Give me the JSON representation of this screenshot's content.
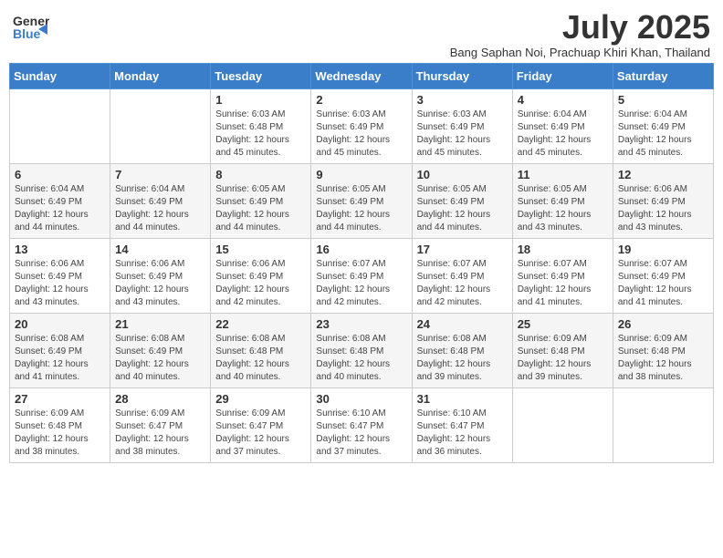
{
  "logo": {
    "general": "General",
    "blue": "Blue"
  },
  "title": {
    "month_year": "July 2025",
    "location": "Bang Saphan Noi, Prachuap Khiri Khan, Thailand"
  },
  "days_of_week": [
    "Sunday",
    "Monday",
    "Tuesday",
    "Wednesday",
    "Thursday",
    "Friday",
    "Saturday"
  ],
  "weeks": [
    [
      {
        "day": "",
        "sunrise": "",
        "sunset": "",
        "daylight": ""
      },
      {
        "day": "",
        "sunrise": "",
        "sunset": "",
        "daylight": ""
      },
      {
        "day": "1",
        "sunrise": "Sunrise: 6:03 AM",
        "sunset": "Sunset: 6:48 PM",
        "daylight": "Daylight: 12 hours and 45 minutes."
      },
      {
        "day": "2",
        "sunrise": "Sunrise: 6:03 AM",
        "sunset": "Sunset: 6:49 PM",
        "daylight": "Daylight: 12 hours and 45 minutes."
      },
      {
        "day": "3",
        "sunrise": "Sunrise: 6:03 AM",
        "sunset": "Sunset: 6:49 PM",
        "daylight": "Daylight: 12 hours and 45 minutes."
      },
      {
        "day": "4",
        "sunrise": "Sunrise: 6:04 AM",
        "sunset": "Sunset: 6:49 PM",
        "daylight": "Daylight: 12 hours and 45 minutes."
      },
      {
        "day": "5",
        "sunrise": "Sunrise: 6:04 AM",
        "sunset": "Sunset: 6:49 PM",
        "daylight": "Daylight: 12 hours and 45 minutes."
      }
    ],
    [
      {
        "day": "6",
        "sunrise": "Sunrise: 6:04 AM",
        "sunset": "Sunset: 6:49 PM",
        "daylight": "Daylight: 12 hours and 44 minutes."
      },
      {
        "day": "7",
        "sunrise": "Sunrise: 6:04 AM",
        "sunset": "Sunset: 6:49 PM",
        "daylight": "Daylight: 12 hours and 44 minutes."
      },
      {
        "day": "8",
        "sunrise": "Sunrise: 6:05 AM",
        "sunset": "Sunset: 6:49 PM",
        "daylight": "Daylight: 12 hours and 44 minutes."
      },
      {
        "day": "9",
        "sunrise": "Sunrise: 6:05 AM",
        "sunset": "Sunset: 6:49 PM",
        "daylight": "Daylight: 12 hours and 44 minutes."
      },
      {
        "day": "10",
        "sunrise": "Sunrise: 6:05 AM",
        "sunset": "Sunset: 6:49 PM",
        "daylight": "Daylight: 12 hours and 44 minutes."
      },
      {
        "day": "11",
        "sunrise": "Sunrise: 6:05 AM",
        "sunset": "Sunset: 6:49 PM",
        "daylight": "Daylight: 12 hours and 43 minutes."
      },
      {
        "day": "12",
        "sunrise": "Sunrise: 6:06 AM",
        "sunset": "Sunset: 6:49 PM",
        "daylight": "Daylight: 12 hours and 43 minutes."
      }
    ],
    [
      {
        "day": "13",
        "sunrise": "Sunrise: 6:06 AM",
        "sunset": "Sunset: 6:49 PM",
        "daylight": "Daylight: 12 hours and 43 minutes."
      },
      {
        "day": "14",
        "sunrise": "Sunrise: 6:06 AM",
        "sunset": "Sunset: 6:49 PM",
        "daylight": "Daylight: 12 hours and 43 minutes."
      },
      {
        "day": "15",
        "sunrise": "Sunrise: 6:06 AM",
        "sunset": "Sunset: 6:49 PM",
        "daylight": "Daylight: 12 hours and 42 minutes."
      },
      {
        "day": "16",
        "sunrise": "Sunrise: 6:07 AM",
        "sunset": "Sunset: 6:49 PM",
        "daylight": "Daylight: 12 hours and 42 minutes."
      },
      {
        "day": "17",
        "sunrise": "Sunrise: 6:07 AM",
        "sunset": "Sunset: 6:49 PM",
        "daylight": "Daylight: 12 hours and 42 minutes."
      },
      {
        "day": "18",
        "sunrise": "Sunrise: 6:07 AM",
        "sunset": "Sunset: 6:49 PM",
        "daylight": "Daylight: 12 hours and 41 minutes."
      },
      {
        "day": "19",
        "sunrise": "Sunrise: 6:07 AM",
        "sunset": "Sunset: 6:49 PM",
        "daylight": "Daylight: 12 hours and 41 minutes."
      }
    ],
    [
      {
        "day": "20",
        "sunrise": "Sunrise: 6:08 AM",
        "sunset": "Sunset: 6:49 PM",
        "daylight": "Daylight: 12 hours and 41 minutes."
      },
      {
        "day": "21",
        "sunrise": "Sunrise: 6:08 AM",
        "sunset": "Sunset: 6:49 PM",
        "daylight": "Daylight: 12 hours and 40 minutes."
      },
      {
        "day": "22",
        "sunrise": "Sunrise: 6:08 AM",
        "sunset": "Sunset: 6:48 PM",
        "daylight": "Daylight: 12 hours and 40 minutes."
      },
      {
        "day": "23",
        "sunrise": "Sunrise: 6:08 AM",
        "sunset": "Sunset: 6:48 PM",
        "daylight": "Daylight: 12 hours and 40 minutes."
      },
      {
        "day": "24",
        "sunrise": "Sunrise: 6:08 AM",
        "sunset": "Sunset: 6:48 PM",
        "daylight": "Daylight: 12 hours and 39 minutes."
      },
      {
        "day": "25",
        "sunrise": "Sunrise: 6:09 AM",
        "sunset": "Sunset: 6:48 PM",
        "daylight": "Daylight: 12 hours and 39 minutes."
      },
      {
        "day": "26",
        "sunrise": "Sunrise: 6:09 AM",
        "sunset": "Sunset: 6:48 PM",
        "daylight": "Daylight: 12 hours and 38 minutes."
      }
    ],
    [
      {
        "day": "27",
        "sunrise": "Sunrise: 6:09 AM",
        "sunset": "Sunset: 6:48 PM",
        "daylight": "Daylight: 12 hours and 38 minutes."
      },
      {
        "day": "28",
        "sunrise": "Sunrise: 6:09 AM",
        "sunset": "Sunset: 6:47 PM",
        "daylight": "Daylight: 12 hours and 38 minutes."
      },
      {
        "day": "29",
        "sunrise": "Sunrise: 6:09 AM",
        "sunset": "Sunset: 6:47 PM",
        "daylight": "Daylight: 12 hours and 37 minutes."
      },
      {
        "day": "30",
        "sunrise": "Sunrise: 6:10 AM",
        "sunset": "Sunset: 6:47 PM",
        "daylight": "Daylight: 12 hours and 37 minutes."
      },
      {
        "day": "31",
        "sunrise": "Sunrise: 6:10 AM",
        "sunset": "Sunset: 6:47 PM",
        "daylight": "Daylight: 12 hours and 36 minutes."
      },
      {
        "day": "",
        "sunrise": "",
        "sunset": "",
        "daylight": ""
      },
      {
        "day": "",
        "sunrise": "",
        "sunset": "",
        "daylight": ""
      }
    ]
  ]
}
